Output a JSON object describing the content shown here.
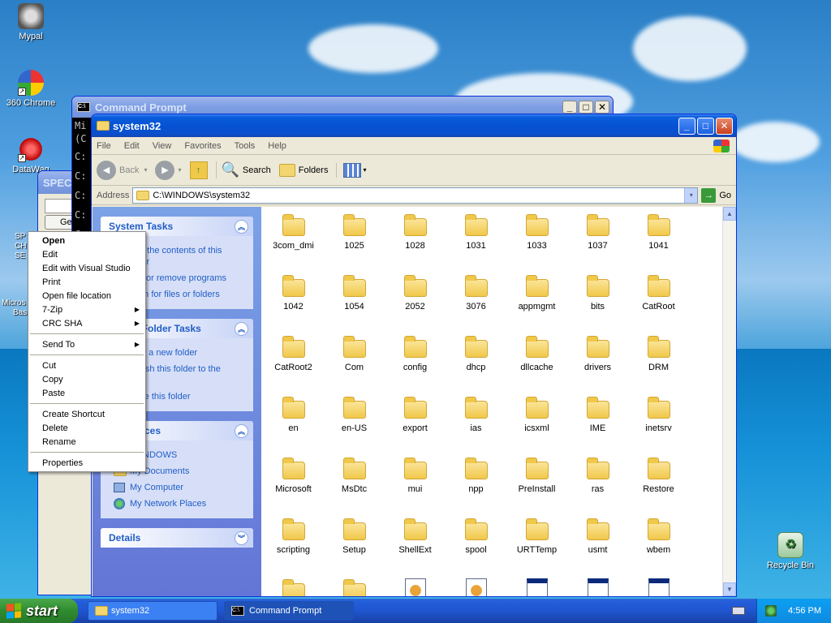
{
  "desktop": {
    "icons": [
      {
        "label": "Mypal"
      },
      {
        "label": "360 Chrome"
      },
      {
        "label": "DataWag"
      }
    ],
    "recycle_bin": "Recycle Bin"
  },
  "cmd_window": {
    "title": "Command Prompt",
    "lines": [
      "Mi",
      "(C",
      "C:",
      "C:",
      "C:",
      "C:",
      "C:"
    ]
  },
  "background_window": {
    "title": "SPEC",
    "field_label": "Ge"
  },
  "explorer": {
    "title": "system32",
    "menu": [
      "File",
      "Edit",
      "View",
      "Favorites",
      "Tools",
      "Help"
    ],
    "toolbar": {
      "back": "Back",
      "search": "Search",
      "folders": "Folders"
    },
    "address": {
      "label": "Address",
      "value": "C:\\WINDOWS\\system32",
      "go": "Go"
    },
    "taskpane": {
      "system_tasks": {
        "title": "System Tasks",
        "links": [
          "e the contents of this\nler",
          "or remove programs",
          "rch for files or folders"
        ]
      },
      "folder_tasks": {
        "title": "l Folder Tasks",
        "links": [
          "e a new folder",
          "lish this folder to the\nb",
          "re this folder"
        ]
      },
      "other_places": {
        "title": "laces",
        "links": [
          "NDOWS",
          "My Documents",
          "My Computer",
          "My Network Places"
        ]
      },
      "details": {
        "title": "Details"
      }
    },
    "folders": [
      "3com_dmi",
      "1025",
      "1028",
      "1031",
      "1033",
      "1037",
      "1041",
      "1042",
      "1054",
      "2052",
      "3076",
      "appmgmt",
      "bits",
      "CatRoot",
      "CatRoot2",
      "Com",
      "config",
      "dhcp",
      "dllcache",
      "drivers",
      "DRM",
      "en",
      "en-US",
      "export",
      "ias",
      "icsxml",
      "IME",
      "inetsrv",
      "Microsoft",
      "MsDtc",
      "mui",
      "npp",
      "PreInstall",
      "ras",
      "Restore",
      "scripting",
      "Setup",
      "ShellExt",
      "spool",
      "URTTemp",
      "usmt",
      "wbem"
    ]
  },
  "context_menu": {
    "groups": [
      [
        "Open",
        "Edit",
        "Edit with Visual Studio",
        "Print",
        "Open file location",
        "7-Zip",
        "CRC SHA"
      ],
      [
        "Send To"
      ],
      [
        "Cut",
        "Copy",
        "Paste"
      ],
      [
        "Create Shortcut",
        "Delete",
        "Rename"
      ],
      [
        "Properties"
      ]
    ]
  },
  "left_partial_labels": [
    "SP",
    "CH",
    "SE",
    "Micros",
    "Bas"
  ],
  "taskbar": {
    "start": "start",
    "tasks": [
      "system32",
      "Command Prompt"
    ],
    "clock": "4:56 PM"
  },
  "colors": {
    "xp_blue": "#0552d3",
    "taskpane_link": "#215dc6",
    "start_green": "#3a9a3a"
  }
}
